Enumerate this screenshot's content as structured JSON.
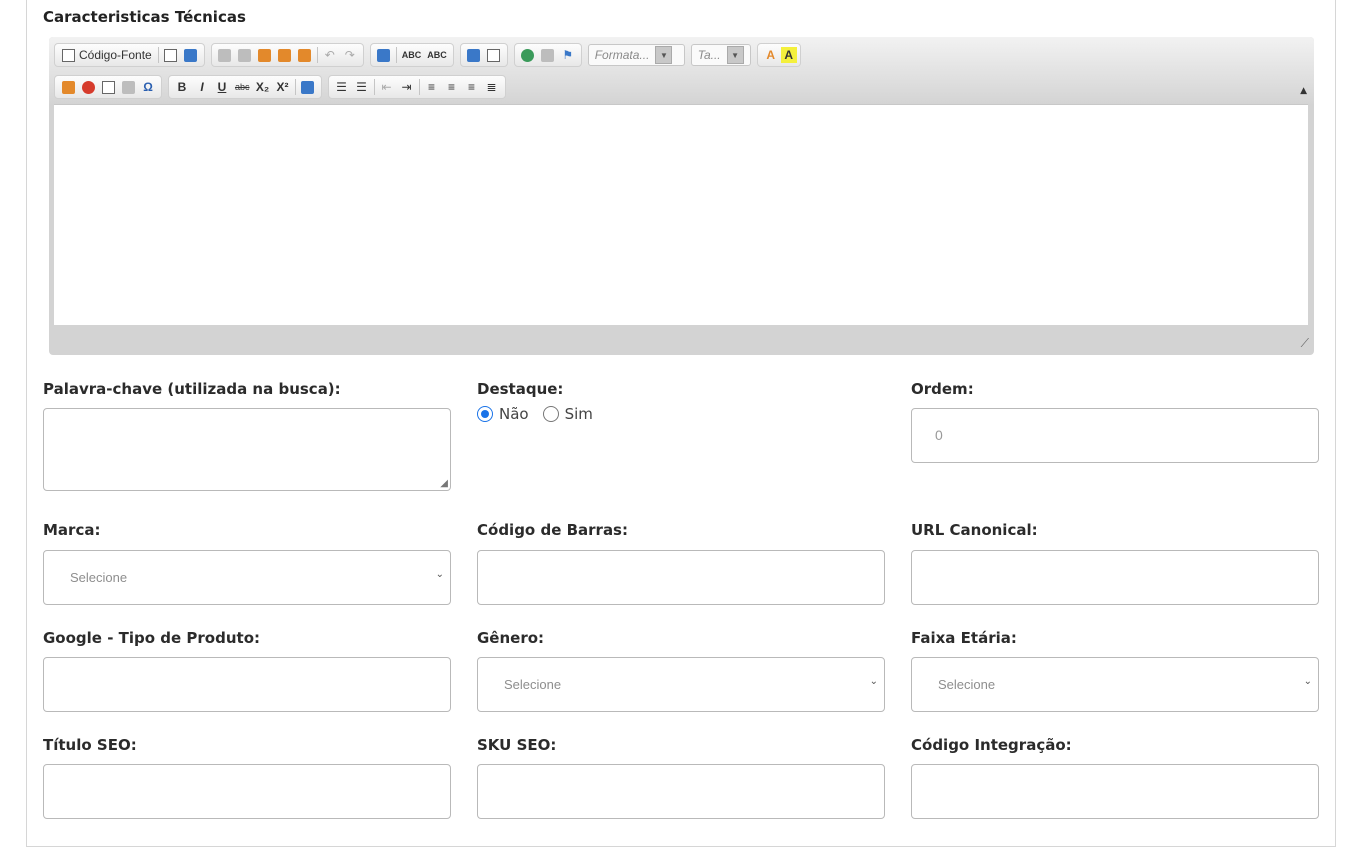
{
  "section": {
    "title": "Caracteristicas Técnicas"
  },
  "editor": {
    "source_label": "Código-Fonte",
    "format_placeholder": "Formata...",
    "size_placeholder": "Ta...",
    "bold": "B",
    "italic": "I",
    "underline": "U",
    "strike": "abc",
    "subscript": "X₂",
    "superscript": "X²",
    "special_char": "Ω",
    "spell1": "ABC",
    "spell2": "ABC",
    "text_color": "A",
    "bg_color": "A",
    "collapse": "▲",
    "grip": "⟋"
  },
  "fields": {
    "keyword": {
      "label": "Palavra-chave (utilizada na busca):",
      "value": ""
    },
    "highlight": {
      "label": "Destaque:",
      "options": [
        "Não",
        "Sim"
      ],
      "selected": "Não"
    },
    "order": {
      "label": "Ordem:",
      "value": "0"
    },
    "brand": {
      "label": "Marca:",
      "placeholder": "Selecione"
    },
    "barcode": {
      "label": "Código de Barras:",
      "value": ""
    },
    "canonical": {
      "label": "URL Canonical:",
      "value": ""
    },
    "google_type": {
      "label": "Google - Tipo de Produto:",
      "value": ""
    },
    "gender": {
      "label": "Gênero:",
      "placeholder": "Selecione"
    },
    "age": {
      "label": "Faixa Etária:",
      "placeholder": "Selecione"
    },
    "seo_title": {
      "label": "Título SEO:",
      "value": ""
    },
    "sku_seo": {
      "label": "SKU SEO:",
      "value": ""
    },
    "integration": {
      "label": "Código Integração:",
      "value": ""
    }
  },
  "colors": {
    "radio_accent": "#1a73e8",
    "border": "#b9b9b9"
  }
}
